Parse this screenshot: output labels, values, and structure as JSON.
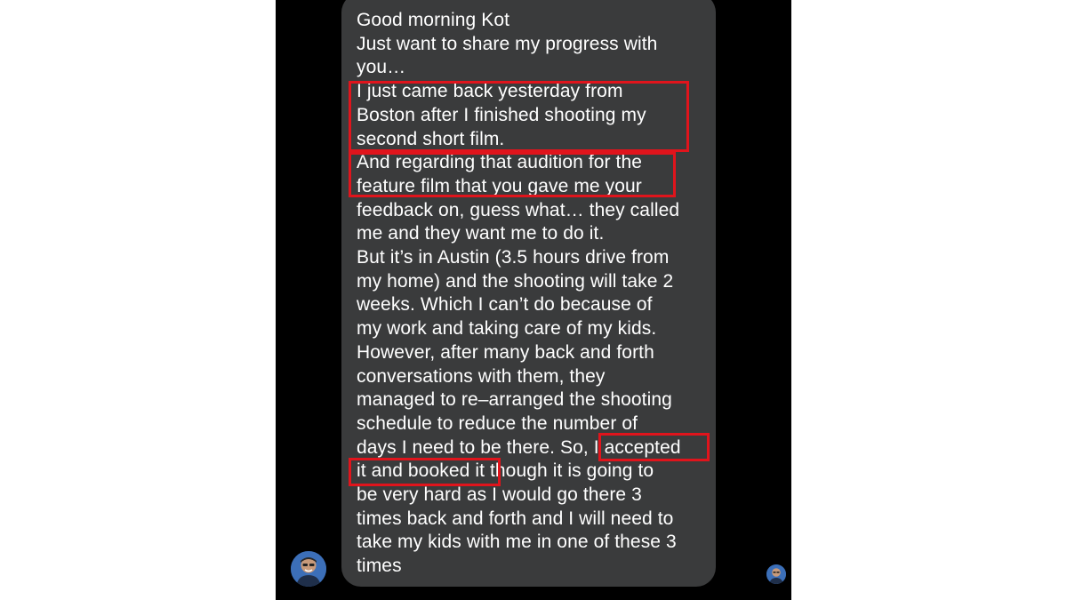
{
  "conversation": {
    "message_lines": [
      "Good morning Kot",
      "Just want to share my progress with",
      "you…",
      "I just came back yesterday from",
      "Boston after I finished shooting my",
      "second short film.",
      "And regarding that audition for the",
      "feature film that you gave me your",
      "feedback on, guess what… they called",
      "me and they want me to do it.",
      "But it’s in Austin (3.5 hours drive from",
      "my home) and the shooting will take 2",
      "weeks. Which I can’t do because of",
      "my work and taking care of my kids.",
      "However, after many back and forth",
      "conversations with them, they",
      "managed to re–arranged the shooting",
      "schedule to reduce the number of",
      "days I need to be there. So, I accepted",
      "it and booked it though it is going to",
      "be very hard as I would go there 3",
      "times back and forth and I will need to",
      "take my kids with me in one of these 3",
      "times"
    ]
  },
  "colors": {
    "background": "#000000",
    "bubble": "#3a3b3c",
    "text": "#ffffff",
    "highlight_box": "#e0141c"
  },
  "icons": {
    "sender_avatar": "avatar-icon",
    "seen_receipt": "read-receipt-avatar-icon"
  }
}
